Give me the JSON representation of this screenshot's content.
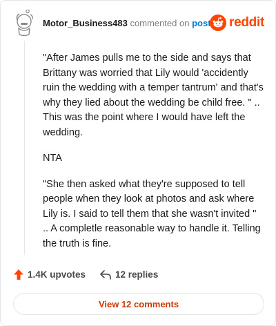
{
  "comment": {
    "username": "Motor_Business483",
    "commented_on_text": "commented on",
    "post_link": "post",
    "paragraphs": [
      "\"After James pulls me to the side and says that Brittany was worried that Lily would 'accidently ruin the wedding with a temper tantrum' and that's why they lied about the wedding be child free. \" .. This was the point where I would have left the wedding.",
      "NTA",
      "\"She then asked what they're supposed to tell people when they look at photos and ask where Lily is. I said to tell them that she wasn't invited \" .. A completle reasonable way to handle it. Telling the truth is fine."
    ]
  },
  "brand": {
    "wordmark": "reddit",
    "color": "#ff4500"
  },
  "actions": {
    "upvotes": "1.4K upvotes",
    "upvote_icon": "upvote-arrow-icon",
    "replies": "12 replies",
    "reply_icon": "reply-arrow-icon",
    "upvote_color": "#ff4500"
  },
  "footer": {
    "view_comments": "View 12 comments"
  }
}
